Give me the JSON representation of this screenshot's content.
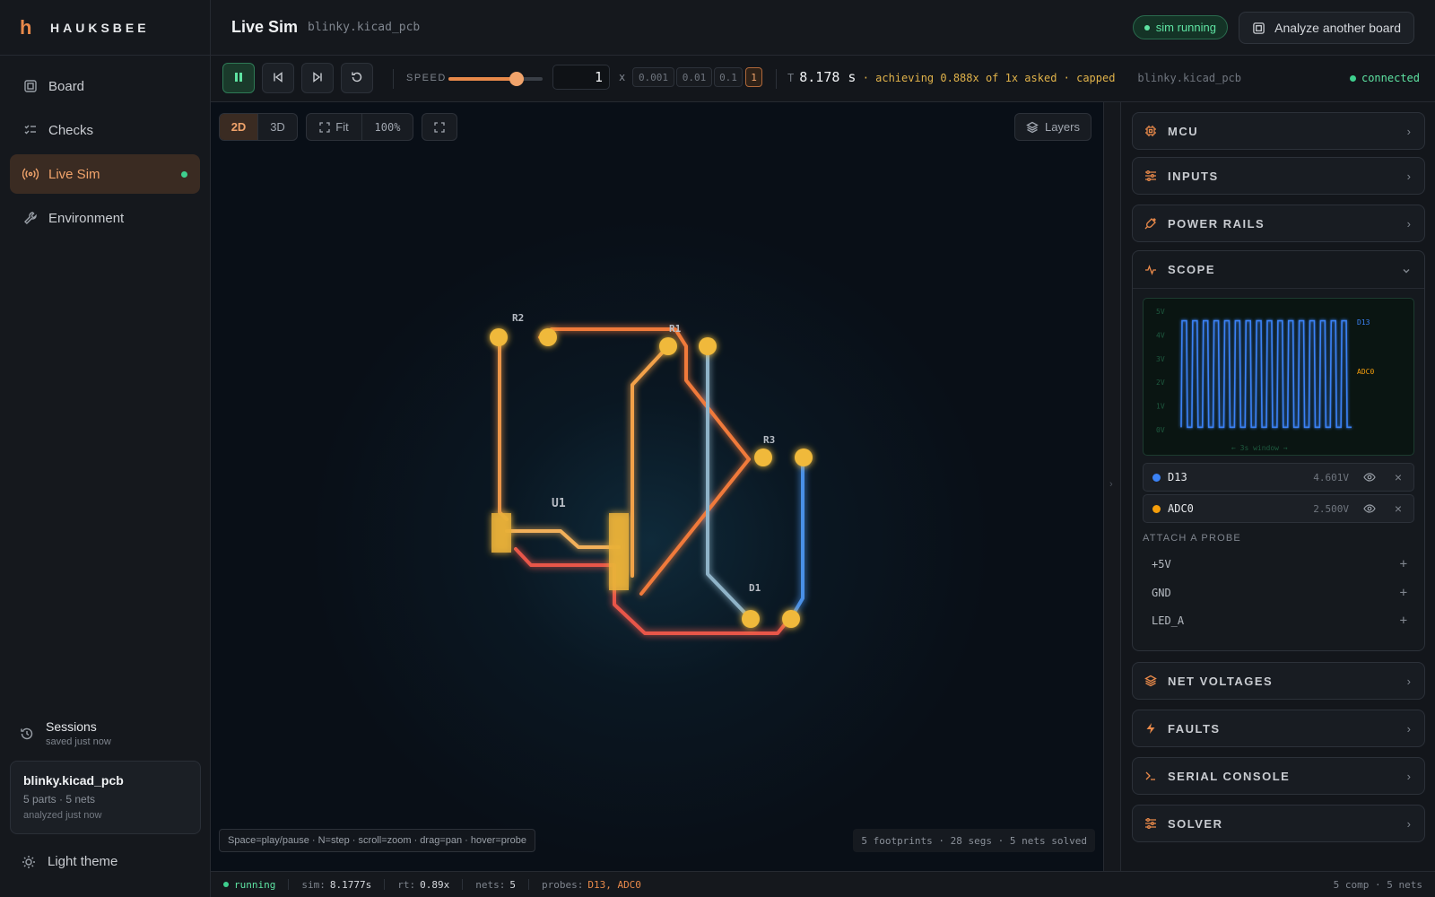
{
  "brand": {
    "logo": "h",
    "name": "HAUKSBEE"
  },
  "nav": [
    {
      "label": "Board",
      "icon": "board-icon",
      "active": false
    },
    {
      "label": "Checks",
      "icon": "checklist-icon",
      "active": false
    },
    {
      "label": "Live Sim",
      "icon": "broadcast-icon",
      "active": true
    },
    {
      "label": "Environment",
      "icon": "wrench-icon",
      "active": false
    }
  ],
  "sessions": {
    "label": "Sessions",
    "sub": "saved just now"
  },
  "session_card": {
    "title": "blinky.kicad_pcb",
    "meta": "5 parts · 5 nets",
    "sub": "analyzed just now"
  },
  "theme_toggle": "Light theme",
  "header": {
    "title": "Live Sim",
    "file": "blinky.kicad_pcb",
    "badge": "sim running",
    "analyze_button": "Analyze another board"
  },
  "toolbar": {
    "speed_label": "SPEED",
    "speed_fraction": 0.72,
    "speed_value": "1",
    "speed_x": "x",
    "presets": [
      {
        "label": "0.001",
        "on": false
      },
      {
        "label": "0.01",
        "on": false
      },
      {
        "label": "0.1",
        "on": false
      },
      {
        "label": "1",
        "on": true
      }
    ],
    "time_label": "T",
    "time_value": "8.178 s",
    "time_note": "· achieving 0.888x of 1x asked · capped",
    "conn_file": "blinky.kicad_pcb",
    "conn_status": "connected"
  },
  "canvas": {
    "view_modes": [
      {
        "label": "2D",
        "on": true
      },
      {
        "label": "3D",
        "on": false
      }
    ],
    "fit_label": "Fit",
    "zoom": "100%",
    "layers_label": "Layers",
    "hint": "Space=play/pause · N=step · scroll=zoom · drag=pan · hover=probe",
    "stats": "5 footprints · 28 segs · 5 nets solved",
    "refs": {
      "r1": "R1",
      "r2": "R2",
      "r3": "R3",
      "u1": "U1",
      "d1": "D1"
    }
  },
  "panel": {
    "sections_top": [
      "MCU",
      "INPUTS",
      "POWER RAILS"
    ],
    "scope": {
      "title": "SCOPE",
      "y_ticks": [
        "5V",
        "4V",
        "3V",
        "2V",
        "1V",
        "0V"
      ],
      "window_label": "← 3s window →",
      "traces": [
        {
          "name": "D13",
          "value": "4.601V",
          "color": "#3b82f6"
        },
        {
          "name": "ADC0",
          "value": "2.500V",
          "color": "#f59e0b"
        }
      ],
      "attach_label": "ATTACH A PROBE",
      "attach": [
        "+5V",
        "GND",
        "LED_A"
      ]
    },
    "sections_bottom": [
      "NET VOLTAGES",
      "FAULTS",
      "SERIAL CONSOLE",
      "SOLVER"
    ]
  },
  "statusbar": {
    "state": "running",
    "sim_label": "sim:",
    "sim_value": "8.1777s",
    "rt_label": "rt:",
    "rt_value": "0.89x",
    "nets_label": "nets:",
    "nets_value": "5",
    "probes_label": "probes:",
    "probes_value": "D13, ADC0",
    "right": "5 comp · 5 nets"
  }
}
